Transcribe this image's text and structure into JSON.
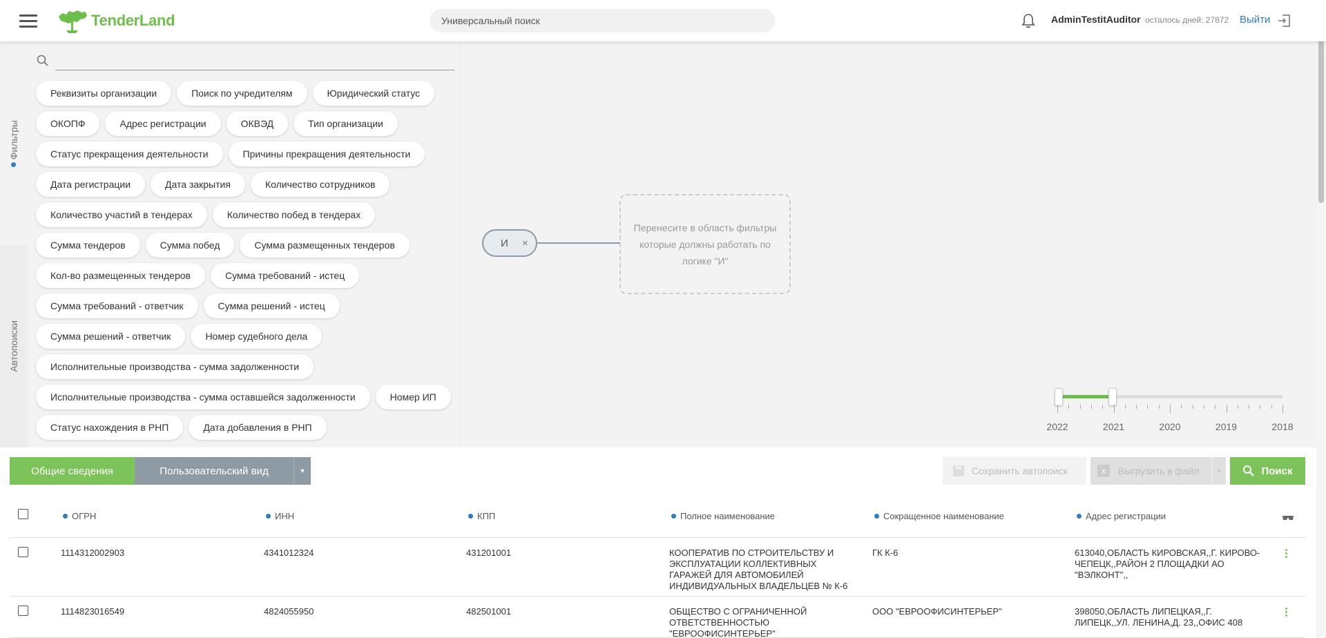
{
  "header": {
    "logo_text": "TenderLand",
    "search_placeholder": "Универсальный поиск",
    "username": "AdminTestitAuditor",
    "days_left": "осталось дней: 27872",
    "logout_label": "Выйти"
  },
  "sidebar": {
    "tabs": [
      {
        "label": "Фильтры",
        "active": true
      },
      {
        "label": "Автопоиски",
        "active": false
      }
    ]
  },
  "filters": {
    "search_value": "",
    "chips": [
      "Реквизиты организации",
      "Поиск по учредителям",
      "Юридический статус",
      "ОКОПФ",
      "Адрес регистрации",
      "ОКВЭД",
      "Тип организации",
      "Статус прекращения деятельности",
      "Причины прекращения деятельности",
      "Дата регистрации",
      "Дата закрытия",
      "Количество сотрудников",
      "Количество участий в тендерах",
      "Количество побед в тендерах",
      "Сумма тендеров",
      "Сумма побед",
      "Сумма размещенных тендеров",
      "Кол-во размещенных тендеров",
      "Сумма требований - истец",
      "Сумма требований - ответчик",
      "Сумма решений - истец",
      "Сумма решений - ответчик",
      "Номер судебного дела",
      "Исполнительные производства - сумма задолженности",
      "Исполнительные производства - сумма оставшейся задолженности",
      "Номер ИП",
      "Статус нахождения в РНП",
      "Дата добавления в РНП"
    ]
  },
  "logic": {
    "node_label": "И",
    "remove_glyph": "×",
    "drop_hint": "Перенесите в область фильтры которые должны работать по логике \"И\""
  },
  "year_slider": {
    "years": [
      "2022",
      "2021",
      "2020",
      "2019",
      "2018"
    ],
    "selected_from": "2022",
    "selected_to": "2021",
    "accent": "#6cbf4a"
  },
  "toolbar": {
    "general_label": "Общие сведения",
    "custom_label": "Пользовательский вид",
    "save_label": "Сохранить автопоиск",
    "export_label": "Выгрузить в файл",
    "search_label": "Поиск"
  },
  "table": {
    "columns": [
      "ОГРН",
      "ИНН",
      "КПП",
      "Полное наименование",
      "Сокращенное наименование",
      "Адрес регистрации"
    ],
    "rows": [
      {
        "ogrn": "1114312002903",
        "inn": "4341012324",
        "kpp": "431201001",
        "full_name": "КООПЕРАТИВ ПО СТРОИТЕЛЬСТВУ И ЭКСПЛУАТАЦИИ КОЛЛЕКТИВНЫХ ГАРАЖЕЙ ДЛЯ АВТОМОБИЛЕЙ ИНДИВИДУАЛЬНЫХ ВЛАДЕЛЬЦЕВ № К-6",
        "short_name": "ГК К-6",
        "address": "613040,ОБЛАСТЬ КИРОВСКАЯ,,Г. КИРОВО-ЧЕПЕЦК,,РАЙОН 2 ПЛОЩАДКИ АО \"ВЭЛКОНТ\",,"
      },
      {
        "ogrn": "1114823016549",
        "inn": "4824055950",
        "kpp": "482501001",
        "full_name": "ОБЩЕСТВО С ОГРАНИЧЕННОЙ ОТВЕТСТВЕННОСТЬЮ \"ЕВРООФИСИНТЕРЬЕР\"",
        "short_name": "ООО \"ЕВРООФИСИНТЕРЬЕР\"",
        "address": "398050,ОБЛАСТЬ ЛИПЕЦКАЯ,,Г. ЛИПЕЦК,,УЛ. ЛЕНИНА,Д. 23,,ОФИС 408"
      }
    ]
  },
  "colors": {
    "brand_green": "#7cc35a",
    "link_blue": "#2d7fc1",
    "secondary_gray": "#8e9aa4"
  }
}
